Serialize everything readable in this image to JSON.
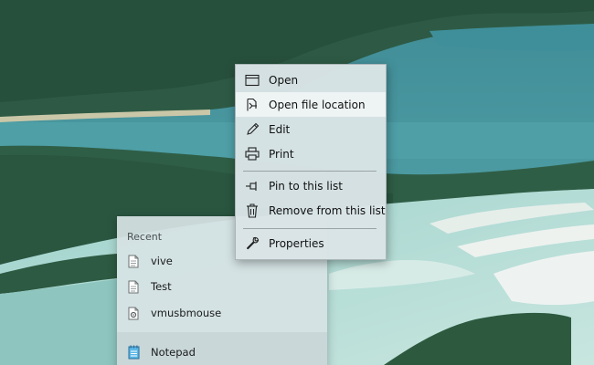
{
  "context_menu": {
    "items": [
      {
        "label": "Open",
        "icon": "window-icon"
      },
      {
        "label": "Open file location",
        "icon": "file-location-icon",
        "highlighted": true
      },
      {
        "label": "Edit",
        "icon": "pencil-icon"
      },
      {
        "label": "Print",
        "icon": "printer-icon"
      },
      {
        "label": "Pin to this list",
        "icon": "pin-icon"
      },
      {
        "label": "Remove from this list",
        "icon": "trash-icon"
      },
      {
        "label": "Properties",
        "icon": "wrench-icon"
      }
    ]
  },
  "jump_list": {
    "section_header": "Recent",
    "recent_items": [
      {
        "label": "vive",
        "icon": "text-file-icon"
      },
      {
        "label": "Test",
        "icon": "text-file-icon"
      },
      {
        "label": "vmusbmouse",
        "icon": "setup-info-file-icon"
      }
    ],
    "pinned_app": {
      "label": "Notepad",
      "icon": "notepad-icon"
    }
  },
  "colors": {
    "menu_background": "#dae4e6",
    "menu_highlight": "#f3f6f7",
    "jumplist_background": "#d6e2e4"
  }
}
